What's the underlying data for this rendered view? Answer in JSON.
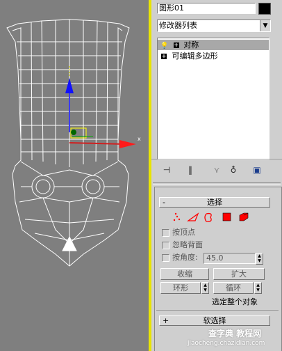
{
  "object": {
    "name": "图形01",
    "color": "#000000"
  },
  "modifier_list": {
    "label": "修改器列表"
  },
  "stack": {
    "items": [
      {
        "label": "对称",
        "selected": true,
        "icon": "lightbulb-icon"
      },
      {
        "label": "可编辑多边形",
        "selected": false,
        "icon": "plus-icon"
      }
    ]
  },
  "selection_rollout": {
    "title": "选择",
    "title_sign": "-",
    "ignore_backface": "忽略背面",
    "by_vertex": "按顶点",
    "by_angle": "按角度:",
    "angle_value": "45.0",
    "shrink": "收缩",
    "grow": "扩大",
    "ring": "环形",
    "loop": "循环",
    "whole_object": "选定整个对象",
    "subobject_colors": [
      "#ff0000",
      "#ff0000",
      "#ff0000",
      "#ff0000",
      "#ff0000"
    ]
  },
  "soft_selection_rollout": {
    "title": "软选择",
    "title_sign": "+"
  },
  "viewport": {
    "axis_x_label": "x"
  },
  "watermark": {
    "line1": "查字典 教程网",
    "line2": "jiaocheng.chazidian.com"
  }
}
